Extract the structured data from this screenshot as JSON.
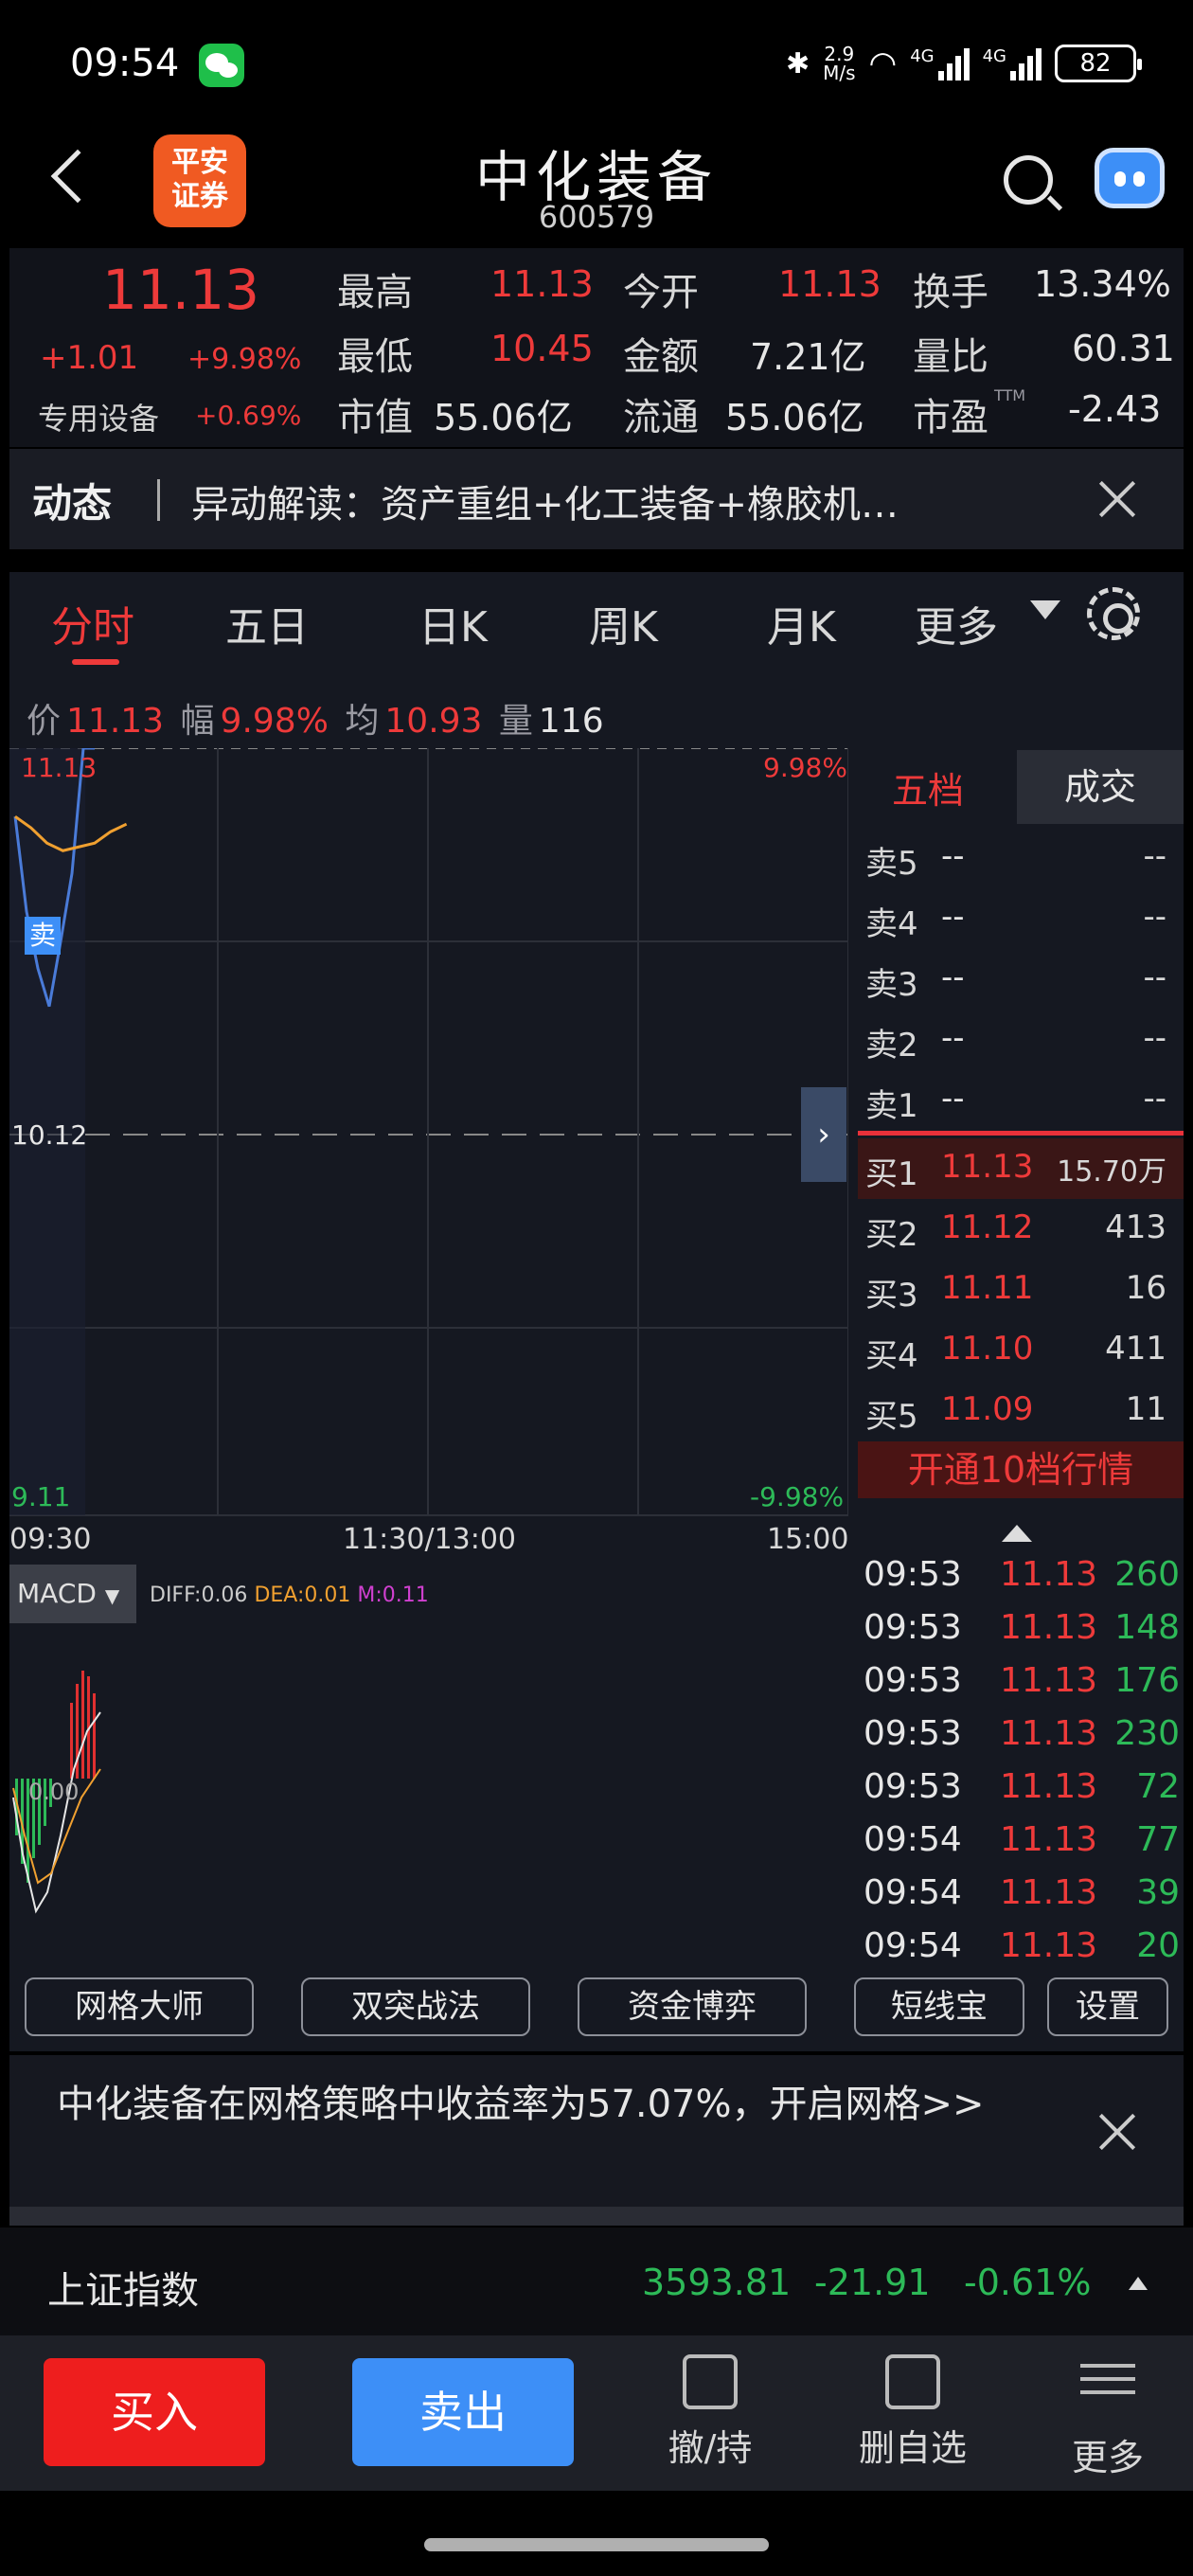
{
  "status_bar": {
    "time": "09:54",
    "speed": "2.9\nM/s",
    "sig1": "4G",
    "sig2": "4G",
    "battery": "82"
  },
  "nav": {
    "logo_text": "平安\n证券",
    "name": "中化装备",
    "code": "600579"
  },
  "quote": {
    "price": "11.13",
    "change": "+1.01",
    "change_pct": "+9.98%",
    "sector": "专用设备",
    "sector_pct": "+0.69%",
    "high_label": "最高",
    "high": "11.13",
    "open_label": "今开",
    "open": "11.13",
    "turnover_label": "换手",
    "turnover": "13.34%",
    "low_label": "最低",
    "low": "10.45",
    "amount_label": "金额",
    "amount": "7.21亿",
    "vol_ratio_label": "量比",
    "vol_ratio": "60.31",
    "mcap_label": "市值",
    "mcap": "55.06亿",
    "float_label": "流通",
    "float": "55.06亿",
    "pe_label": "市盈",
    "pe_sup": "TTM",
    "pe": "-2.43"
  },
  "news": {
    "tag": "动态",
    "text": "异动解读：资产重组+化工装备+橡胶机…"
  },
  "tabs": [
    "分时",
    "五日",
    "日K",
    "周K",
    "月K",
    "更多"
  ],
  "info_line": {
    "price_label": "价",
    "price": "11.13",
    "amp_label": "幅",
    "amp": "9.98%",
    "avg_label": "均",
    "avg": "10.93",
    "vol_label": "量",
    "vol": "116"
  },
  "chart": {
    "price_top": "11.13",
    "pct_top": "9.98%",
    "price_mid": "10.12",
    "price_bottom": "9.11",
    "pct_bottom": "-9.98%",
    "time_start": "09:30",
    "time_mid": "11:30/13:00",
    "time_end": "15:00",
    "sell_marker": "卖",
    "macd_label": "MACD",
    "macd_zero": "0.00",
    "diff": "DIFF:0.06",
    "dea": "DEA:0.01",
    "m": "M:0.11"
  },
  "chart_data": {
    "type": "line",
    "series": [
      {
        "name": "价",
        "values": [
          10.95,
          10.7,
          10.55,
          10.45,
          10.62,
          10.8,
          11.13,
          11.13
        ]
      },
      {
        "name": "均",
        "values": [
          10.95,
          10.92,
          10.88,
          10.86,
          10.87,
          10.88,
          10.91,
          10.93
        ]
      }
    ],
    "ylim": [
      9.11,
      11.13
    ]
  },
  "orderbook": {
    "tab_active": "五档",
    "tab_other": "成交",
    "sells": [
      {
        "label": "卖5",
        "price": "--",
        "vol": "--"
      },
      {
        "label": "卖4",
        "price": "--",
        "vol": "--"
      },
      {
        "label": "卖3",
        "price": "--",
        "vol": "--"
      },
      {
        "label": "卖2",
        "price": "--",
        "vol": "--"
      },
      {
        "label": "卖1",
        "price": "--",
        "vol": "--"
      }
    ],
    "buys": [
      {
        "label": "买1",
        "price": "11.13",
        "vol": "15.70万"
      },
      {
        "label": "买2",
        "price": "11.12",
        "vol": "413"
      },
      {
        "label": "买3",
        "price": "11.11",
        "vol": "16"
      },
      {
        "label": "买4",
        "price": "11.10",
        "vol": "411"
      },
      {
        "label": "买5",
        "price": "11.09",
        "vol": "11"
      }
    ],
    "open_level10": "开通10档行情"
  },
  "ticks": [
    {
      "time": "09:53",
      "price": "11.13",
      "vol": "260"
    },
    {
      "time": "09:53",
      "price": "11.13",
      "vol": "148"
    },
    {
      "time": "09:53",
      "price": "11.13",
      "vol": "176"
    },
    {
      "time": "09:53",
      "price": "11.13",
      "vol": "230"
    },
    {
      "time": "09:53",
      "price": "11.13",
      "vol": "72"
    },
    {
      "time": "09:54",
      "price": "11.13",
      "vol": "77"
    },
    {
      "time": "09:54",
      "price": "11.13",
      "vol": "39"
    },
    {
      "time": "09:54",
      "price": "11.13",
      "vol": "20"
    }
  ],
  "strategies": [
    "网格大师",
    "双突战法",
    "资金博弈",
    "短线宝",
    "设置"
  ],
  "grid_tip": "中化装备在网格策略中收益率为57.07%，开启网格>>",
  "index": {
    "name": "上证指数",
    "value": "3593.81",
    "change": "-21.91",
    "pct": "-0.61%"
  },
  "bottom": {
    "buy": "买入",
    "sell": "卖出",
    "cancel": "撤/持",
    "del_fav": "删自选",
    "more": "更多"
  },
  "colors": {
    "up": "#ee3a3a",
    "down": "#2dba58",
    "accent": "#3d8ff7"
  }
}
